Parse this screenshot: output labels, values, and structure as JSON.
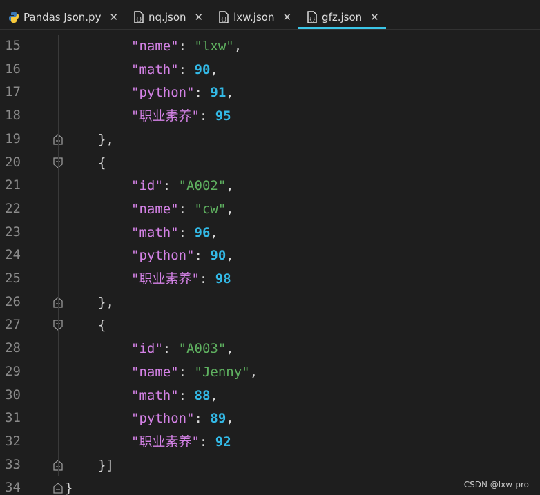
{
  "tabs": [
    {
      "label": "Pandas Json.py",
      "icon": "python-file-icon",
      "active": false
    },
    {
      "label": "nq.json",
      "icon": "json-file-icon",
      "active": false
    },
    {
      "label": "lxw.json",
      "icon": "json-file-icon",
      "active": false
    },
    {
      "label": "gfz.json",
      "icon": "json-file-icon",
      "active": true
    }
  ],
  "tab_close_glyph": "✕",
  "colors": {
    "background": "#1e1e1e",
    "active_tab_underline": "#3bc6e8",
    "key": "#d482e6",
    "string": "#5fb160",
    "number": "#33b9e6",
    "line_number": "#8b8b8b"
  },
  "lines": [
    {
      "num": "15",
      "tokens": [
        {
          "t": "k",
          "v": "\"name\""
        },
        {
          "t": "p",
          "v": ": "
        },
        {
          "t": "s",
          "v": "\"lxw\""
        },
        {
          "t": "p",
          "v": ","
        }
      ]
    },
    {
      "num": "16",
      "tokens": [
        {
          "t": "k",
          "v": "\"math\""
        },
        {
          "t": "p",
          "v": ": "
        },
        {
          "t": "n",
          "v": "90"
        },
        {
          "t": "p",
          "v": ","
        }
      ]
    },
    {
      "num": "17",
      "tokens": [
        {
          "t": "k",
          "v": "\"python\""
        },
        {
          "t": "p",
          "v": ": "
        },
        {
          "t": "n",
          "v": "91"
        },
        {
          "t": "p",
          "v": ","
        }
      ]
    },
    {
      "num": "18",
      "tokens": [
        {
          "t": "k",
          "v": "\"职业素养\""
        },
        {
          "t": "p",
          "v": ": "
        },
        {
          "t": "n",
          "v": "95"
        }
      ]
    },
    {
      "num": "19",
      "tokens": [
        {
          "t": "c",
          "v": "},"
        }
      ]
    },
    {
      "num": "20",
      "tokens": [
        {
          "t": "c",
          "v": "{"
        }
      ]
    },
    {
      "num": "21",
      "tokens": [
        {
          "t": "k",
          "v": "\"id\""
        },
        {
          "t": "p",
          "v": ": "
        },
        {
          "t": "s",
          "v": "\"A002\""
        },
        {
          "t": "p",
          "v": ","
        }
      ]
    },
    {
      "num": "22",
      "tokens": [
        {
          "t": "k",
          "v": "\"name\""
        },
        {
          "t": "p",
          "v": ": "
        },
        {
          "t": "s",
          "v": "\"cw\""
        },
        {
          "t": "p",
          "v": ","
        }
      ]
    },
    {
      "num": "23",
      "tokens": [
        {
          "t": "k",
          "v": "\"math\""
        },
        {
          "t": "p",
          "v": ": "
        },
        {
          "t": "n",
          "v": "96"
        },
        {
          "t": "p",
          "v": ","
        }
      ]
    },
    {
      "num": "24",
      "tokens": [
        {
          "t": "k",
          "v": "\"python\""
        },
        {
          "t": "p",
          "v": ": "
        },
        {
          "t": "n",
          "v": "90"
        },
        {
          "t": "p",
          "v": ","
        }
      ]
    },
    {
      "num": "25",
      "tokens": [
        {
          "t": "k",
          "v": "\"职业素养\""
        },
        {
          "t": "p",
          "v": ": "
        },
        {
          "t": "n",
          "v": "98"
        }
      ]
    },
    {
      "num": "26",
      "tokens": [
        {
          "t": "c",
          "v": "},"
        }
      ]
    },
    {
      "num": "27",
      "tokens": [
        {
          "t": "c",
          "v": "{"
        }
      ]
    },
    {
      "num": "28",
      "tokens": [
        {
          "t": "k",
          "v": "\"id\""
        },
        {
          "t": "p",
          "v": ": "
        },
        {
          "t": "s",
          "v": "\"A003\""
        },
        {
          "t": "p",
          "v": ","
        }
      ]
    },
    {
      "num": "29",
      "tokens": [
        {
          "t": "k",
          "v": "\"name\""
        },
        {
          "t": "p",
          "v": ": "
        },
        {
          "t": "s",
          "v": "\"Jenny\""
        },
        {
          "t": "p",
          "v": ","
        }
      ]
    },
    {
      "num": "30",
      "tokens": [
        {
          "t": "k",
          "v": "\"math\""
        },
        {
          "t": "p",
          "v": ": "
        },
        {
          "t": "n",
          "v": "88"
        },
        {
          "t": "p",
          "v": ","
        }
      ]
    },
    {
      "num": "31",
      "tokens": [
        {
          "t": "k",
          "v": "\"python\""
        },
        {
          "t": "p",
          "v": ": "
        },
        {
          "t": "n",
          "v": "89"
        },
        {
          "t": "p",
          "v": ","
        }
      ]
    },
    {
      "num": "32",
      "tokens": [
        {
          "t": "k",
          "v": "\"职业素养\""
        },
        {
          "t": "p",
          "v": ": "
        },
        {
          "t": "n",
          "v": "92"
        }
      ]
    },
    {
      "num": "33",
      "tokens": [
        {
          "t": "c",
          "v": "}]"
        }
      ]
    },
    {
      "num": "34",
      "tokens": [
        {
          "t": "c",
          "v": "}"
        }
      ]
    }
  ],
  "watermark": "CSDN @lxw-pro"
}
